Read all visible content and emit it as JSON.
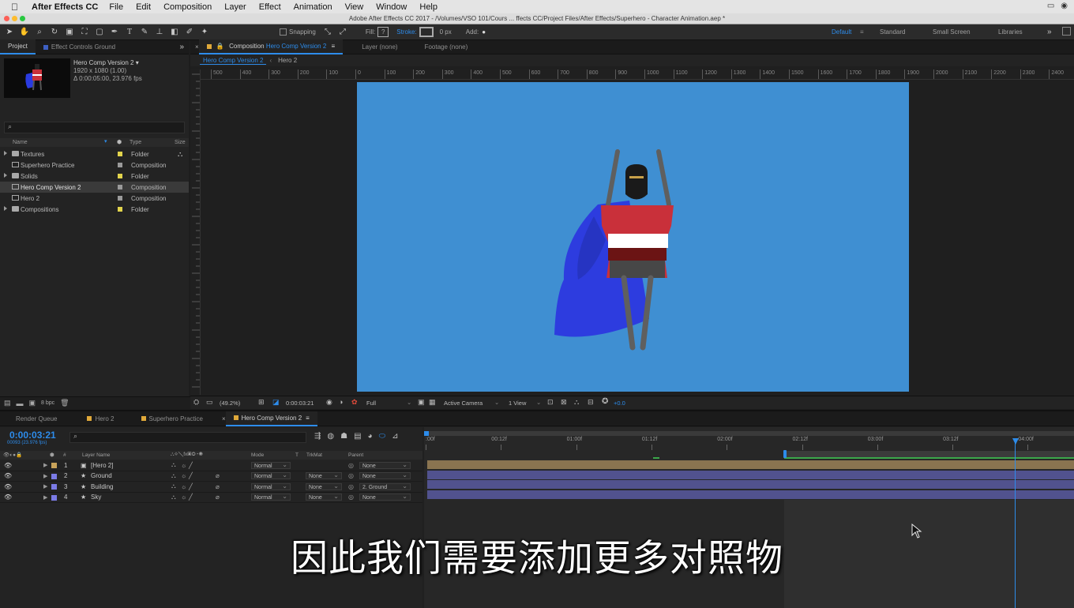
{
  "menubar": {
    "app": "After Effects CC",
    "items": [
      "File",
      "Edit",
      "Composition",
      "Layer",
      "Effect",
      "Animation",
      "View",
      "Window",
      "Help"
    ]
  },
  "titlebar": {
    "text": "Adobe After Effects CC 2017 - /Volumes/VSO 101/Cours ... ffects CC/Project Files/After Effects/Superhero - Character Animation.aep *"
  },
  "toolbar": {
    "snapping": "Snapping",
    "fill": "Fill:",
    "stroke": "Stroke:",
    "stroke_px": "0 px",
    "add": "Add:",
    "workspaces": [
      "Default",
      "Standard",
      "Small Screen",
      "Libraries"
    ],
    "active_workspace": "Default"
  },
  "project_panel": {
    "tabs": [
      "Project",
      "Effect Controls Ground"
    ],
    "comp_name": "Hero Comp Version 2 ▾",
    "comp_size": "1920 x 1080 (1.00)",
    "comp_duration": "Δ 0:00:05:00, 23.976 fps",
    "columns": {
      "name": "Name",
      "type": "Type",
      "size": "Size"
    },
    "items": [
      {
        "name": "Textures",
        "type": "Folder",
        "kind": "folder"
      },
      {
        "name": "Superhero Practice",
        "type": "Composition",
        "kind": "comp"
      },
      {
        "name": "Solids",
        "type": "Folder",
        "kind": "folder"
      },
      {
        "name": "Hero Comp Version 2",
        "type": "Composition",
        "kind": "comp",
        "selected": true
      },
      {
        "name": "Hero 2",
        "type": "Composition",
        "kind": "comp"
      },
      {
        "name": "Compositions",
        "type": "Folder",
        "kind": "folder"
      }
    ],
    "bpc": "8 bpc"
  },
  "viewer": {
    "tabs": {
      "composition_prefix": "Composition",
      "composition_name": "Hero Comp Version 2",
      "layer": "Layer (none)",
      "footage": "Footage (none)"
    },
    "subtabs": [
      "Hero Comp Version 2",
      "Hero 2"
    ],
    "ruler_labels": [
      "500",
      "400",
      "300",
      "200",
      "100",
      "0",
      "100",
      "200",
      "300",
      "400",
      "500",
      "600",
      "700",
      "800",
      "900",
      "1000",
      "1100",
      "1200",
      "1300",
      "1400",
      "1500",
      "1600",
      "1700",
      "1800",
      "1900",
      "2000",
      "2100",
      "2200",
      "2300",
      "2400"
    ],
    "canvas_color": "#3f8fd2",
    "zoom": "(49.2%)",
    "timecode": "0:00:03:21",
    "resolution": "Full",
    "camera": "Active Camera",
    "views": "1 View",
    "exposure": "+0.0"
  },
  "timeline": {
    "tabs": [
      "Render Queue",
      "Hero 2",
      "Superhero Practice",
      "Hero Comp Version 2"
    ],
    "active_tab": "Hero Comp Version 2",
    "current_time": "0:00:03:21",
    "frames": "00093 (23.976 fps)",
    "columns": {
      "layer_name": "Layer Name",
      "num": "#",
      "mode": "Mode",
      "t": "T",
      "trkmat": "TrkMat",
      "parent": "Parent"
    },
    "layers": [
      {
        "num": "1",
        "name": "[Hero 2]",
        "mode": "Normal",
        "trkmat": "",
        "parent": "None",
        "color": "#c8a35a"
      },
      {
        "num": "2",
        "name": "Ground",
        "mode": "Normal",
        "trkmat": "None",
        "parent": "None",
        "color": "#7b7be6"
      },
      {
        "num": "3",
        "name": "Building",
        "mode": "Normal",
        "trkmat": "None",
        "parent": "2. Ground",
        "color": "#7b7be6"
      },
      {
        "num": "4",
        "name": "Sky",
        "mode": "Normal",
        "trkmat": "None",
        "parent": "None",
        "color": "#7b7be6"
      }
    ],
    "ruler_labels": [
      ":00f",
      "00:12f",
      "01:00f",
      "01:12f",
      "02:00f",
      "02:12f",
      "03:00f",
      "03:12f",
      "04:00f"
    ]
  },
  "subtitle": "因此我们需要添加更多对照物"
}
